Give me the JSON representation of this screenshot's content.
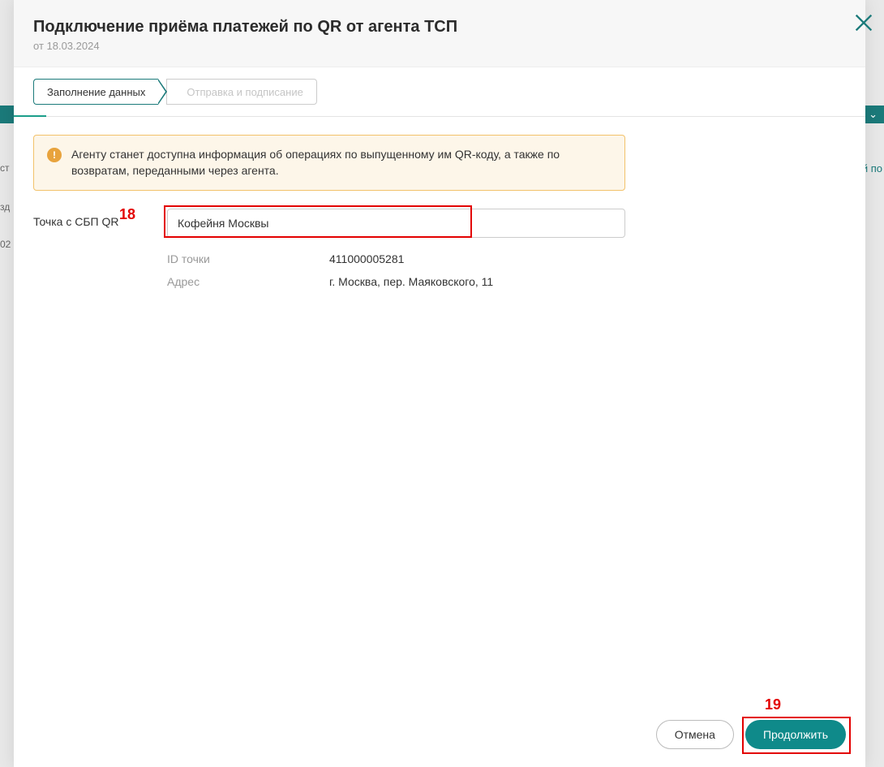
{
  "background": {
    "teal_text": "ние ⌄",
    "blue_link": "ный по",
    "left1": "ст",
    "left2": "зд",
    "left3": "02"
  },
  "header": {
    "title": "Подключение приёма платежей по QR от агента ТСП",
    "subtitle": "от 18.03.2024"
  },
  "stepper": {
    "step1": "Заполнение данных",
    "step2": "Отправка и подписание"
  },
  "alert": {
    "text": "Агенту станет доступна информация об операциях по выпущенному им QR-коду, а также по возвратам, переданными через агента."
  },
  "form": {
    "point_label": "Точка с СБП QR",
    "point_value": "Кофейня Москвы",
    "id_label": "ID точки",
    "id_value": "411000005281",
    "address_label": "Адрес",
    "address_value": "г. Москва, пер. Маяковского, 11"
  },
  "footer": {
    "cancel": "Отмена",
    "continue": "Продолжить"
  },
  "markers": {
    "m18": "18",
    "m19": "19"
  }
}
